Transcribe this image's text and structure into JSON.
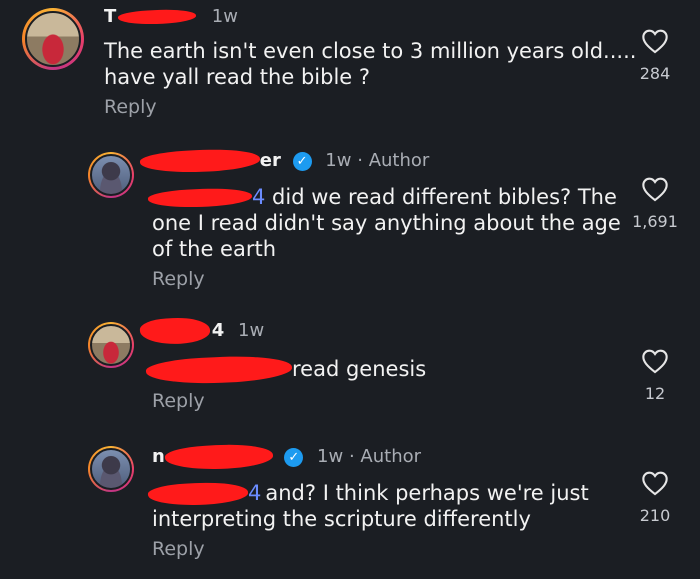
{
  "comments": [
    {
      "username_fragment": "T",
      "time": "1w",
      "author": "",
      "text_line1": "The earth isn't even close to 3 million years old.....",
      "text_line2": "have yall read the bible ?",
      "reply": "Reply",
      "likes": "284",
      "avatar_icon": "car-photo"
    },
    {
      "username_fragment": "er",
      "time": "1w",
      "author": "Author",
      "mention_fragment": "4",
      "text_line1": " did we read different bibles? The",
      "text_line2": "one I read didn't say anything about the age",
      "text_line3": "of the earth",
      "reply": "Reply",
      "likes": "1,691",
      "avatar_icon": "person-photo"
    },
    {
      "username_fragment": "4",
      "time": "1w",
      "author": "",
      "text_line1": "read genesis",
      "reply": "Reply",
      "likes": "12",
      "avatar_icon": "car-photo"
    },
    {
      "username_fragment": "n",
      "time": "1w",
      "author": "Author",
      "mention_fragment": "4",
      "text_line1": "and? I think perhaps we're just",
      "text_line2": "interpreting the scripture differently",
      "reply": "Reply",
      "likes": "210",
      "avatar_icon": "person-photo"
    }
  ],
  "separator": "·",
  "verified_glyph": "✓",
  "colors": {
    "background": "#1b1e23",
    "redaction": "#ff1a1a",
    "verified": "#1d9bf0"
  }
}
